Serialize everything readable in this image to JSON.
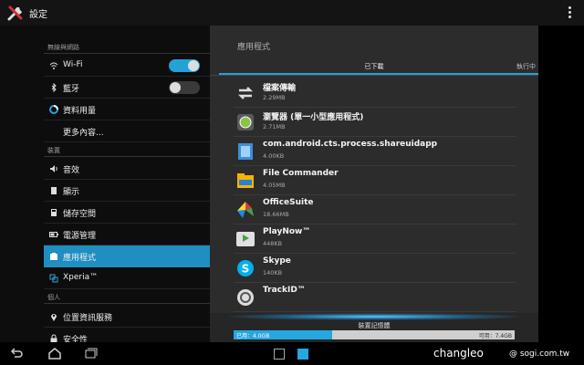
{
  "app": {
    "title": "設定"
  },
  "sidebar": {
    "wireless_header": "無線與網路",
    "device_header": "裝置",
    "personal_header": "個人",
    "items": [
      {
        "label": "Wi-Fi",
        "toggle": "on"
      },
      {
        "label": "藍牙",
        "toggle": "off"
      },
      {
        "label": "資料用量"
      },
      {
        "label": "更多內容..."
      },
      {
        "label": "音效"
      },
      {
        "label": "顯示"
      },
      {
        "label": "儲存空間"
      },
      {
        "label": "電源管理"
      },
      {
        "label": "應用程式",
        "selected": true
      },
      {
        "label": "Xperia™"
      },
      {
        "label": "位置資訊服務"
      },
      {
        "label": "安全性"
      }
    ]
  },
  "panel": {
    "title": "應用程式",
    "tabs": [
      "已下載",
      "執行中"
    ],
    "apps": [
      {
        "name": "檔案傳輸",
        "size": "2.29MB",
        "icon": "file-transfer-icon"
      },
      {
        "name": "瀏覽器 (單一小型應用程式)",
        "size": "2.71MB",
        "icon": "browser-icon"
      },
      {
        "name": "com.android.cts.process.shareuidapp",
        "size": "4.00KB",
        "icon": "android-app-icon"
      },
      {
        "name": "File Commander",
        "size": "4.05MB",
        "icon": "file-commander-icon"
      },
      {
        "name": "OfficeSuite",
        "size": "18.66MB",
        "icon": "officesuite-icon"
      },
      {
        "name": "PlayNow™",
        "size": "448KB",
        "icon": "playnow-icon"
      },
      {
        "name": "Skype",
        "size": "140KB",
        "icon": "skype-icon"
      },
      {
        "name": "TrackID™",
        "size": "",
        "icon": "trackid-icon"
      }
    ],
    "storage": {
      "label": "裝置記憶體",
      "used": "已用：4.0GB",
      "free": "可用：7.4GB",
      "used_fraction": 0.35
    }
  },
  "watermark": {
    "user": "changleo",
    "site": "@ sogi.com.tw"
  },
  "colors": {
    "accent": "#1f8ec1",
    "toggle_on": "#23a2d8"
  }
}
